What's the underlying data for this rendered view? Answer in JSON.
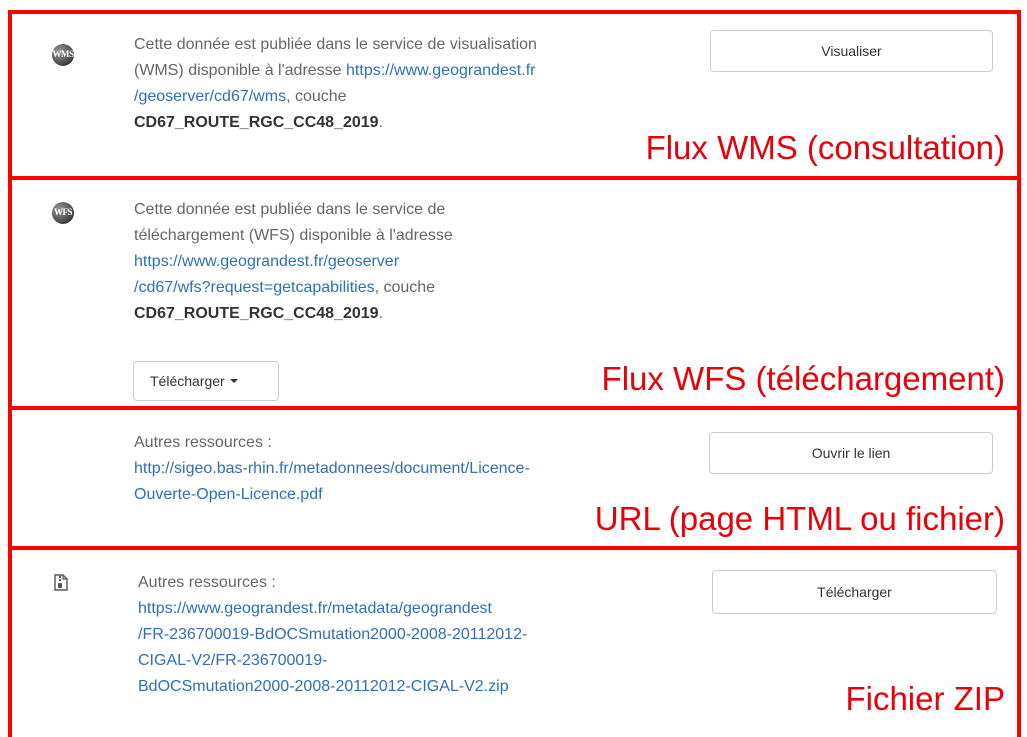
{
  "wms": {
    "icon_text": "WMS",
    "text1": "Cette donnée est publiée dans le service de visualisation",
    "text2": "(WMS) disponible à l'adresse ",
    "link1": "https://www.geograndest.fr",
    "link2": "/geoserver/cd67/wms",
    "text3": ", couche",
    "layer": "CD67_ROUTE_RGC_CC48_2019",
    "period": ".",
    "button": "Visualiser",
    "annotation": "Flux WMS (consultation)"
  },
  "wfs": {
    "icon_text": "WFS",
    "text1": "Cette donnée est publiée dans le service de",
    "text2": "téléchargement (WFS) disponible à l'adresse",
    "link1": "https://www.geograndest.fr/geoserver",
    "link2": "/cd67/wfs?request=getcapabilities",
    "text3": ", couche",
    "layer": "CD67_ROUTE_RGC_CC48_2019",
    "period": ".",
    "button": "Télécharger",
    "annotation": "Flux WFS (téléchargement)"
  },
  "url": {
    "label": "Autres ressources :",
    "link1": "http://sigeo.bas-rhin.fr/metadonnees/document/Licence-",
    "link2": "Ouverte-Open-Licence.pdf",
    "button": "Ouvrir le lien",
    "annotation": "URL (page HTML ou fichier)"
  },
  "zip": {
    "label": "Autres ressources :",
    "link1": "https://www.geograndest.fr/metadata/geograndest",
    "link2": "/FR-236700019-BdOCSmutation2000-2008-20112012-",
    "link3": "CIGAL-V2/FR-236700019-",
    "link4": "BdOCSmutation2000-2008-20112012-CIGAL-V2.zip",
    "button": "Télécharger",
    "annotation": "Fichier ZIP"
  }
}
